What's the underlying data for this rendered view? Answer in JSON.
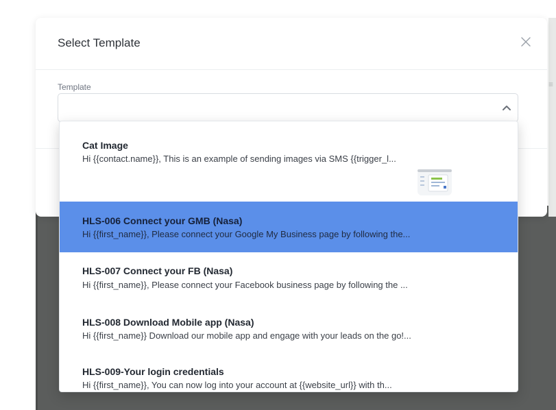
{
  "modal": {
    "title": "Select Template",
    "close_icon": "close-icon"
  },
  "template_field": {
    "label": "Template",
    "value": "",
    "chevron_icon": "chevron-up-icon"
  },
  "dropdown": {
    "options": [
      {
        "title": "Cat Image",
        "description": "Hi {{contact.name}}, This is an example of sending images via SMS {{trigger_l...",
        "thumbnail": "image-thumbnail-icon",
        "selected": false
      },
      {
        "title": "HLS-006 Connect your GMB (Nasa)",
        "description": "Hi {{first_name}}, Please connect your Google My Business page by following the...",
        "selected": true
      },
      {
        "title": "HLS-007 Connect your FB (Nasa)",
        "description": "Hi {{first_name}}, Please connect your Facebook business page by following the ...",
        "selected": false
      },
      {
        "title": "HLS-008 Download Mobile app (Nasa)",
        "description": "Hi {{first_name}} Download our mobile app and engage with your leads on the go!...",
        "selected": false
      },
      {
        "title": "HLS-009-Your login credentials",
        "description": "Hi {{first_name}}, You can now log into your account at {{website_url}} with th...",
        "selected": false
      }
    ]
  },
  "colors": {
    "selected_bg": "#5b8fe9",
    "backdrop": "#5b5d5c",
    "accent_green": "#37b24d"
  }
}
